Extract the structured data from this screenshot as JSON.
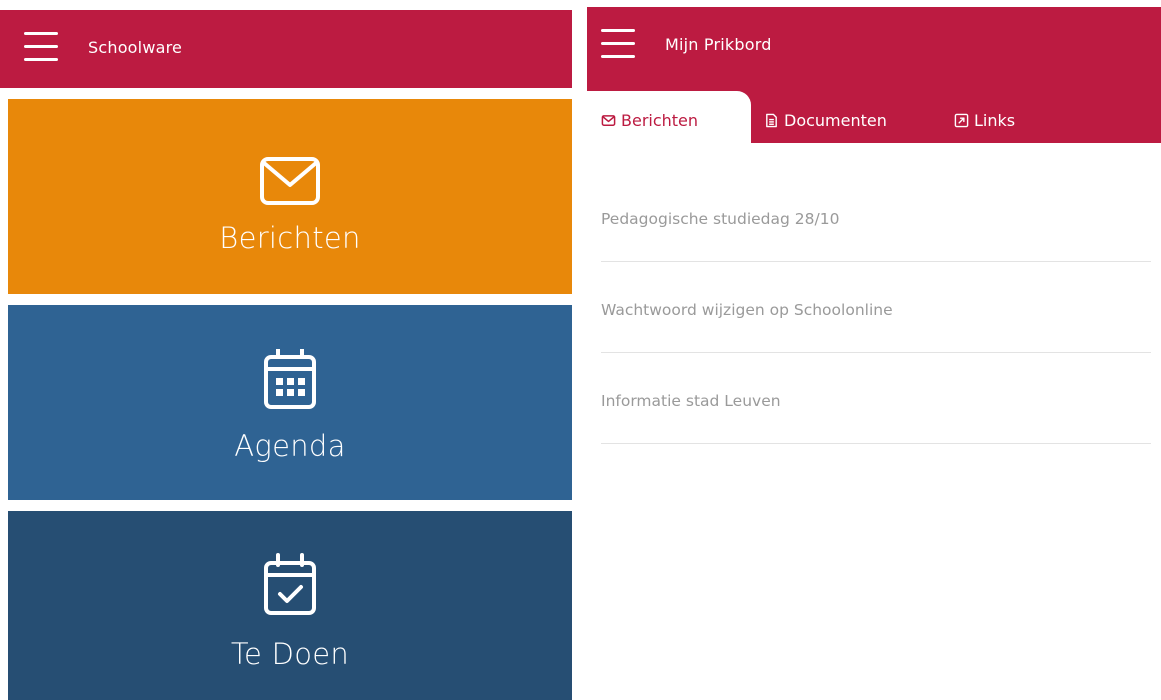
{
  "left": {
    "header": {
      "title": "Schoolware"
    },
    "tiles": [
      {
        "label": "Berichten",
        "icon": "envelope-icon",
        "color": "#e8880a"
      },
      {
        "label": "Agenda",
        "icon": "calendar-icon",
        "color": "#2f6393"
      },
      {
        "label": "Te Doen",
        "icon": "calendar-check-icon",
        "color": "#264e73"
      }
    ]
  },
  "right": {
    "header": {
      "title": "Mijn Prikbord"
    },
    "tabs": [
      {
        "label": "Berichten",
        "icon": "envelope-icon",
        "active": true
      },
      {
        "label": "Documenten",
        "icon": "document-icon",
        "active": false
      },
      {
        "label": "Links",
        "icon": "external-link-icon",
        "active": false
      }
    ],
    "messages": [
      {
        "title": "Pedagogische studiedag 28/10"
      },
      {
        "title": "Wachtwoord wijzigen op Schoolonline"
      },
      {
        "title": "Informatie stad Leuven"
      }
    ]
  },
  "colors": {
    "brand": "#bc1b41",
    "text_muted": "#9a9a9a"
  }
}
